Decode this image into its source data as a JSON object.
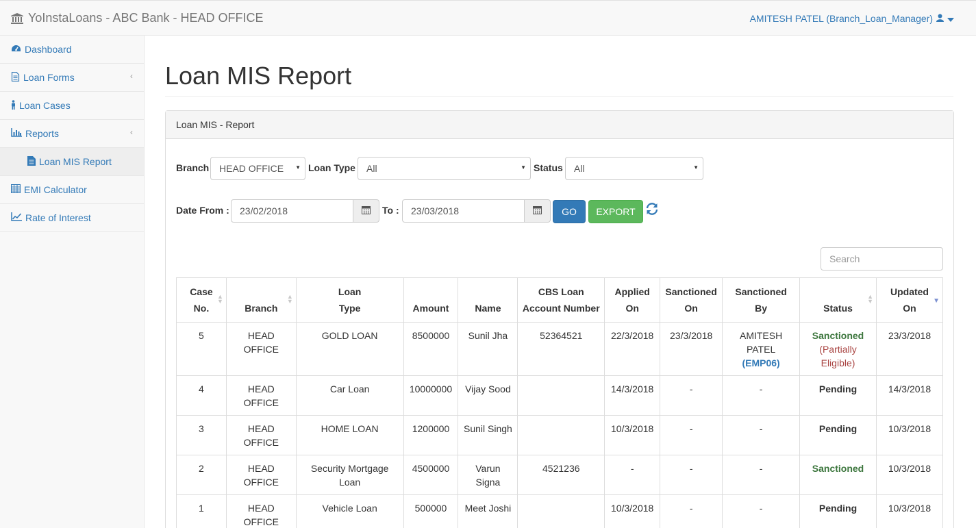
{
  "app": {
    "title": "YoInstaLoans - ABC Bank - HEAD OFFICE",
    "user": "AMITESH PATEL (Branch_Loan_Manager)"
  },
  "sidebar": {
    "items": [
      {
        "label": "Dashboard",
        "icon": "tachometer-icon"
      },
      {
        "label": "Loan Forms",
        "icon": "file-icon"
      },
      {
        "label": "Loan Cases",
        "icon": "person-icon"
      },
      {
        "label": "Reports",
        "icon": "bar-chart-icon"
      },
      {
        "label": "Loan MIS Report",
        "icon": "file-text-icon"
      },
      {
        "label": "EMI Calculator",
        "icon": "calculator-icon"
      },
      {
        "label": "Rate of Interest",
        "icon": "line-chart-icon"
      }
    ]
  },
  "page": {
    "title": "Loan MIS Report",
    "panel_title": "Loan MIS - Report"
  },
  "filters": {
    "branch_label": "Branch",
    "branch_value": "HEAD OFFICE",
    "loan_type_label": "Loan Type",
    "loan_type_value": "All",
    "status_label": "Status",
    "status_value": "All",
    "date_from_label": "Date From :",
    "date_from_value": "23/02/2018",
    "to_label": "To :",
    "to_value": "23/03/2018",
    "go_label": "GO",
    "export_label": "EXPORT",
    "search_placeholder": "Search"
  },
  "table": {
    "headers": [
      {
        "l1": "Case",
        "l2": "No."
      },
      {
        "l1": "",
        "l2": "Branch"
      },
      {
        "l1": "Loan",
        "l2": "Type"
      },
      {
        "l1": "",
        "l2": "Amount"
      },
      {
        "l1": "",
        "l2": "Name"
      },
      {
        "l1": "CBS Loan",
        "l2": "Account Number"
      },
      {
        "l1": "Applied",
        "l2": "On"
      },
      {
        "l1": "Sanctioned",
        "l2": "On"
      },
      {
        "l1": "Sanctioned",
        "l2": "By"
      },
      {
        "l1": "",
        "l2": "Status"
      },
      {
        "l1": "Updated",
        "l2": "On"
      }
    ],
    "rows": [
      {
        "case_no": "5",
        "branch": "HEAD OFFICE",
        "loan_type": "GOLD LOAN",
        "amount": "8500000",
        "name": "Sunil Jha",
        "cbs": "52364521",
        "applied": "22/3/2018",
        "sanctioned_on": "23/3/2018",
        "sanctioned_by": "AMITESH PATEL",
        "sanctioned_by_code": "(EMP06)",
        "status": "Sanctioned",
        "status_note": "(Partially Eligible)",
        "updated": "23/3/2018"
      },
      {
        "case_no": "4",
        "branch": "HEAD OFFICE",
        "loan_type": "Car Loan",
        "amount": "10000000",
        "name": "Vijay Sood",
        "cbs": "",
        "applied": "14/3/2018",
        "sanctioned_on": "-",
        "sanctioned_by": "-",
        "sanctioned_by_code": "",
        "status": "Pending",
        "status_note": "",
        "updated": "14/3/2018"
      },
      {
        "case_no": "3",
        "branch": "HEAD OFFICE",
        "loan_type": "HOME LOAN",
        "amount": "1200000",
        "name": "Sunil Singh",
        "cbs": "",
        "applied": "10/3/2018",
        "sanctioned_on": "-",
        "sanctioned_by": "-",
        "sanctioned_by_code": "",
        "status": "Pending",
        "status_note": "",
        "updated": "10/3/2018"
      },
      {
        "case_no": "2",
        "branch": "HEAD OFFICE",
        "loan_type": "Security Mortgage Loan",
        "amount": "4500000",
        "name": "Varun Signa",
        "cbs": "4521236",
        "applied": "-",
        "sanctioned_on": "-",
        "sanctioned_by": "-",
        "sanctioned_by_code": "",
        "status": "Sanctioned",
        "status_note": "",
        "updated": "10/3/2018"
      },
      {
        "case_no": "1",
        "branch": "HEAD OFFICE",
        "loan_type": "Vehicle Loan",
        "amount": "500000",
        "name": "Meet Joshi",
        "cbs": "",
        "applied": "10/3/2018",
        "sanctioned_on": "-",
        "sanctioned_by": "-",
        "sanctioned_by_code": "",
        "status": "Pending",
        "status_note": "",
        "updated": "10/3/2018"
      }
    ]
  },
  "colors": {
    "link": "#337ab7",
    "success": "#5cb85c",
    "sanctioned": "#3c763d",
    "partial": "#a94442"
  }
}
